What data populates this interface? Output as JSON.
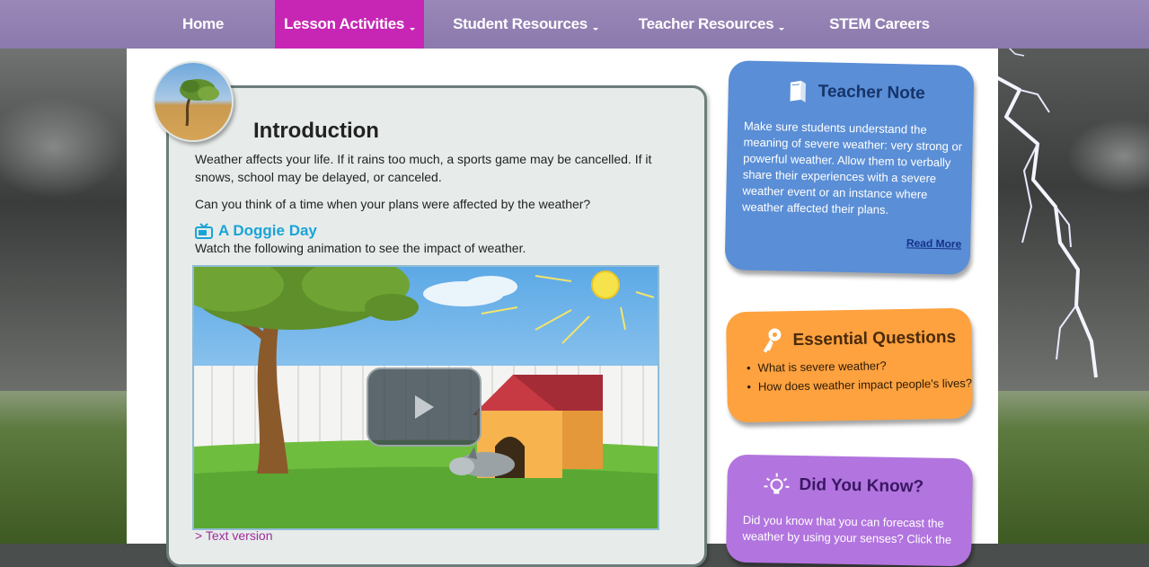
{
  "nav": {
    "items": [
      {
        "label": "Home",
        "has_dropdown": false,
        "active": false
      },
      {
        "label": "Lesson Activities",
        "has_dropdown": true,
        "active": true
      },
      {
        "label": "Student Resources",
        "has_dropdown": true,
        "active": false
      },
      {
        "label": "Teacher Resources",
        "has_dropdown": true,
        "active": false
      },
      {
        "label": "STEM Careers",
        "has_dropdown": false,
        "active": false
      }
    ],
    "active_color": "#c726b4",
    "bar_color": "#9a88b8"
  },
  "intro": {
    "title": "Introduction",
    "paragraph1": "Weather affects your life. If it rains too much, a sports game may be cancelled. If it snows, school may be delayed, or canceled.",
    "paragraph2": "Can you think of a time when your plans were affected by the weather?",
    "video_heading": "A Doggie Day",
    "video_heading_icon": "tv-icon",
    "video_intro": "Watch the following animation to see the impact of weather.",
    "text_version_link": "> Text version"
  },
  "teacher_note": {
    "title": "Teacher Note",
    "icon": "book-icon",
    "body": "Make sure students understand the meaning of severe weather: very strong or powerful weather. Allow them to verbally share their experiences with a severe weather event or an instance where weather affected their plans.",
    "read_more": "Read More",
    "color": "#5a8ed6"
  },
  "essential_questions": {
    "title": "Essential Questions",
    "icon": "key-icon",
    "items": [
      "What is severe weather?",
      "How does weather impact people's lives?"
    ],
    "color": "#fda23f"
  },
  "did_you_know": {
    "title": "Did You Know?",
    "icon": "lightbulb-icon",
    "body": "Did you know that you can forecast the weather by using your senses? Click the",
    "color": "#b274df"
  }
}
